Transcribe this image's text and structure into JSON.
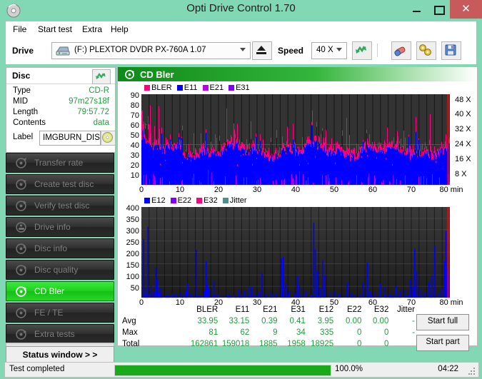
{
  "window": {
    "title": "Opti Drive Control 1.70",
    "icon": "disc-icon",
    "minimize_label": "–",
    "maximize_label": "☐",
    "close_label": "✕",
    "close_color": "#c75b5b",
    "chrome_color": "#82d8b4"
  },
  "menu": [
    {
      "label": "File"
    },
    {
      "label": "Start test"
    },
    {
      "label": "Extra"
    },
    {
      "label": "Help"
    }
  ],
  "toolbar": {
    "drive_label": "Drive",
    "drive_value": "(F:)  PLEXTOR DVDR  PX-760A 1.07",
    "eject_label": "eject",
    "speed_label": "Speed",
    "speed_value": "40 X",
    "refresh_icon": "refresh-icon",
    "erase_icon": "eraser-icon",
    "tools_icon": "tools-icon",
    "save_icon": "save-icon"
  },
  "disc_panel": {
    "title": "Disc",
    "refresh_icon": "refresh-icon",
    "rows": [
      {
        "key": "Type",
        "value": "CD-R"
      },
      {
        "key": "MID",
        "value": "97m27s18f"
      },
      {
        "key": "Length",
        "value": "79:57.72"
      },
      {
        "key": "Contents",
        "value": "data"
      }
    ],
    "label_key": "Label",
    "label_value": "IMGBURN_DIS",
    "label_button_icon": "disc-icon"
  },
  "nav": {
    "items": [
      {
        "label": "Transfer rate",
        "icon": "disc-test-icon",
        "active": false
      },
      {
        "label": "Create test disc",
        "icon": "disc-create-icon",
        "active": false
      },
      {
        "label": "Verify test disc",
        "icon": "disc-verify-icon",
        "active": false
      },
      {
        "label": "Drive info",
        "icon": "drive-info-icon",
        "active": false
      },
      {
        "label": "Disc info",
        "icon": "disc-info-icon",
        "active": false
      },
      {
        "label": "Disc quality",
        "icon": "disc-quality-icon",
        "active": false
      },
      {
        "label": "CD Bler",
        "icon": "cd-bler-icon",
        "active": true
      },
      {
        "label": "FE / TE",
        "icon": "fe-te-icon",
        "active": false
      },
      {
        "label": "Extra tests",
        "icon": "extra-tests-icon",
        "active": false
      }
    ],
    "status_window_label": "Status window > >"
  },
  "main": {
    "title": "CD Bler",
    "icon": "cd-bler-icon",
    "start_full_label": "Start full",
    "start_part_label": "Start part"
  },
  "stats": {
    "columns": [
      "BLER",
      "E11",
      "E21",
      "E31",
      "E12",
      "E22",
      "E32",
      "Jitter"
    ],
    "rows": [
      {
        "label": "Avg",
        "values": [
          "33.95",
          "33.15",
          "0.39",
          "0.41",
          "3.95",
          "0.00",
          "0.00",
          "-"
        ]
      },
      {
        "label": "Max",
        "values": [
          "81",
          "62",
          "9",
          "34",
          "335",
          "0",
          "0",
          "-"
        ]
      },
      {
        "label": "Total",
        "values": [
          "162861",
          "159018",
          "1885",
          "1958",
          "18925",
          "0",
          "0",
          ""
        ]
      }
    ]
  },
  "statusbar": {
    "text": "Test completed",
    "percent": "100.0%",
    "progress": 100,
    "time": "04:22"
  },
  "chart_data": [
    {
      "type": "area",
      "id": "bler-chart",
      "title": "CD Bler",
      "xlabel": "min",
      "ylabel": "",
      "xlim": [
        0,
        80
      ],
      "ylim": [
        0,
        90
      ],
      "xticks": [
        0,
        10,
        20,
        30,
        40,
        50,
        60,
        70,
        80
      ],
      "xticklabels": [
        "0",
        "10",
        "20",
        "30",
        "40",
        "50",
        "60",
        "70",
        "80 min"
      ],
      "yticks": [
        10,
        20,
        30,
        40,
        50,
        60,
        70,
        80,
        90
      ],
      "right_axis": {
        "label": "Speed",
        "ticks": [
          8,
          16,
          24,
          32,
          40,
          48
        ],
        "ticklabels": [
          "8 X",
          "16 X",
          "24 X",
          "32 X",
          "40 X",
          "48 X"
        ],
        "lim": [
          0,
          52
        ],
        "color": "#ff0000"
      },
      "grid": true,
      "legend": [
        {
          "name": "BLER",
          "color": "#ff0080"
        },
        {
          "name": "E11",
          "color": "#0000ff"
        },
        {
          "name": "E21",
          "color": "#bb00ee"
        },
        {
          "name": "E31",
          "color": "#8000ff"
        }
      ],
      "series": [
        {
          "name": "BLER",
          "color": "#ff0080",
          "avg": 33.95,
          "max": 81,
          "total": 162861
        },
        {
          "name": "E11",
          "color": "#0000ff",
          "avg": 33.15,
          "max": 62,
          "total": 159018
        },
        {
          "name": "E21",
          "color": "#bb00ee",
          "avg": 0.39,
          "max": 9,
          "total": 1885
        },
        {
          "name": "E31",
          "color": "#8000ff",
          "avg": 0.41,
          "max": 34,
          "total": 1958
        }
      ],
      "notes": "Dense noisy band: E11 (blue) fills ~0-40, BLER (pink) spikes to ~50-81 across full 0-80 min span. Red speed trace rises at the far right edge near 80 min."
    },
    {
      "type": "line",
      "id": "e1x-chart",
      "xlabel": "min",
      "ylabel": "",
      "xlim": [
        0,
        80
      ],
      "ylim": [
        0,
        400
      ],
      "xticks": [
        0,
        10,
        20,
        30,
        40,
        50,
        60,
        70,
        80
      ],
      "xticklabels": [
        "0",
        "10",
        "20",
        "30",
        "40",
        "50",
        "60",
        "70",
        "80 min"
      ],
      "yticks": [
        50,
        100,
        150,
        200,
        250,
        300,
        350,
        400
      ],
      "grid": true,
      "legend": [
        {
          "name": "E12",
          "color": "#0000ff"
        },
        {
          "name": "E22",
          "color": "#8000ff"
        },
        {
          "name": "E32",
          "color": "#ff0080"
        },
        {
          "name": "Jitter",
          "color": "#4f8f8f"
        }
      ],
      "series": [
        {
          "name": "E12",
          "color": "#0000ff",
          "avg": 3.95,
          "max": 335,
          "total": 18925
        },
        {
          "name": "E22",
          "color": "#8000ff",
          "avg": 0.0,
          "max": 0,
          "total": 0
        },
        {
          "name": "E32",
          "color": "#ff0080",
          "avg": 0.0,
          "max": 0,
          "total": 0
        },
        {
          "name": "Jitter",
          "color": "#4f8f8f",
          "avg": "-",
          "max": "-",
          "total": ""
        }
      ],
      "spikes": [
        {
          "x": 0.6,
          "y": 258
        },
        {
          "x": 1.0,
          "y": 40
        },
        {
          "x": 1.3,
          "y": 20
        },
        {
          "x": 1.7,
          "y": 313
        },
        {
          "x": 2.1,
          "y": 18
        },
        {
          "x": 2.5,
          "y": 52
        },
        {
          "x": 2.9,
          "y": 22
        },
        {
          "x": 3.3,
          "y": 30
        },
        {
          "x": 3.7,
          "y": 133
        },
        {
          "x": 4.1,
          "y": 78
        },
        {
          "x": 4.5,
          "y": 25
        },
        {
          "x": 5.0,
          "y": 42
        },
        {
          "x": 5.4,
          "y": 14
        },
        {
          "x": 6.4,
          "y": 12
        },
        {
          "x": 7.2,
          "y": 10
        },
        {
          "x": 8.1,
          "y": 16
        },
        {
          "x": 9.0,
          "y": 14
        },
        {
          "x": 10.2,
          "y": 22
        },
        {
          "x": 11.0,
          "y": 18
        },
        {
          "x": 11.6,
          "y": 30
        },
        {
          "x": 12.0,
          "y": 62
        },
        {
          "x": 12.6,
          "y": 20
        },
        {
          "x": 14.3,
          "y": 211
        },
        {
          "x": 15.2,
          "y": 12
        },
        {
          "x": 16.4,
          "y": 30
        },
        {
          "x": 16.8,
          "y": 160
        },
        {
          "x": 17.1,
          "y": 58
        },
        {
          "x": 17.5,
          "y": 40
        },
        {
          "x": 18.8,
          "y": 74
        },
        {
          "x": 19.6,
          "y": 18
        },
        {
          "x": 21.0,
          "y": 12
        },
        {
          "x": 22.4,
          "y": 14
        },
        {
          "x": 24.0,
          "y": 10
        },
        {
          "x": 25.3,
          "y": 36
        },
        {
          "x": 26.0,
          "y": 12
        },
        {
          "x": 26.8,
          "y": 30
        },
        {
          "x": 28.0,
          "y": 49
        },
        {
          "x": 28.6,
          "y": 47
        },
        {
          "x": 29.4,
          "y": 14
        },
        {
          "x": 30.4,
          "y": 22
        },
        {
          "x": 31.3,
          "y": 108
        },
        {
          "x": 32.4,
          "y": 16
        },
        {
          "x": 33.6,
          "y": 26
        },
        {
          "x": 34.8,
          "y": 20
        },
        {
          "x": 36.3,
          "y": 175
        },
        {
          "x": 36.8,
          "y": 181
        },
        {
          "x": 37.4,
          "y": 62
        },
        {
          "x": 38.3,
          "y": 30
        },
        {
          "x": 39.6,
          "y": 22
        },
        {
          "x": 40.4,
          "y": 96
        },
        {
          "x": 41.0,
          "y": 55
        },
        {
          "x": 41.8,
          "y": 20
        },
        {
          "x": 42.6,
          "y": 28
        },
        {
          "x": 44.7,
          "y": 330
        },
        {
          "x": 45.1,
          "y": 215
        },
        {
          "x": 45.6,
          "y": 120
        },
        {
          "x": 46.4,
          "y": 40
        },
        {
          "x": 47.0,
          "y": 165
        },
        {
          "x": 47.6,
          "y": 100
        },
        {
          "x": 48.8,
          "y": 22
        },
        {
          "x": 50.2,
          "y": 32
        },
        {
          "x": 51.4,
          "y": 20
        },
        {
          "x": 53.4,
          "y": 70
        },
        {
          "x": 54.4,
          "y": 25
        },
        {
          "x": 56.6,
          "y": 18
        },
        {
          "x": 57.4,
          "y": 68
        },
        {
          "x": 58.6,
          "y": 155
        },
        {
          "x": 59.4,
          "y": 30
        },
        {
          "x": 60.6,
          "y": 24
        },
        {
          "x": 62.0,
          "y": 60
        },
        {
          "x": 63.2,
          "y": 48
        },
        {
          "x": 64.4,
          "y": 18
        },
        {
          "x": 66.0,
          "y": 52
        },
        {
          "x": 67.2,
          "y": 28
        },
        {
          "x": 68.4,
          "y": 34
        },
        {
          "x": 69.8,
          "y": 82
        },
        {
          "x": 70.4,
          "y": 50
        },
        {
          "x": 70.9,
          "y": 215
        },
        {
          "x": 71.4,
          "y": 118
        },
        {
          "x": 72.2,
          "y": 40
        },
        {
          "x": 73.4,
          "y": 22
        },
        {
          "x": 74.6,
          "y": 70
        },
        {
          "x": 75.4,
          "y": 98
        },
        {
          "x": 76.1,
          "y": 228
        },
        {
          "x": 77.0,
          "y": 24
        },
        {
          "x": 78.0,
          "y": 40
        },
        {
          "x": 78.6,
          "y": 160
        },
        {
          "x": 79.0,
          "y": 295
        },
        {
          "x": 79.4,
          "y": 130
        },
        {
          "x": 79.8,
          "y": 100
        }
      ],
      "notes": "Sparse blue E12 spikes on dark background, max 335 near 44.7 min."
    }
  ]
}
